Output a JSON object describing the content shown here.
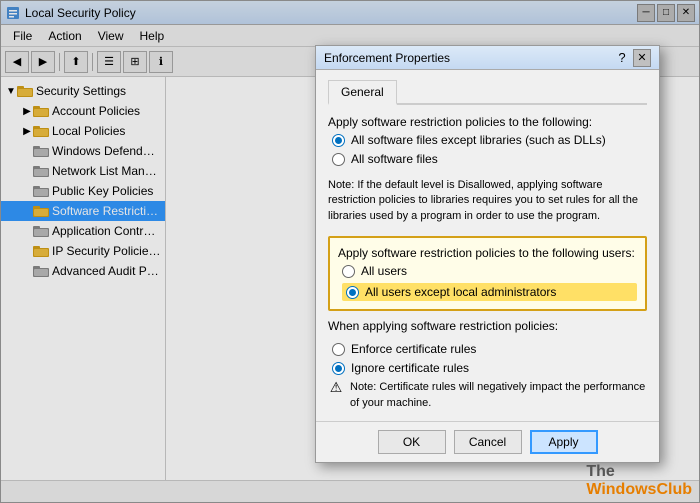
{
  "mainWindow": {
    "title": "Local Security Policy",
    "menu": [
      "File",
      "Action",
      "View",
      "Help"
    ]
  },
  "sidebar": {
    "items": [
      {
        "id": "security-settings",
        "label": "Security Settings",
        "level": 0,
        "expanded": true,
        "selected": false
      },
      {
        "id": "account-policies",
        "label": "Account Policies",
        "level": 1,
        "expanded": false,
        "selected": false
      },
      {
        "id": "local-policies",
        "label": "Local Policies",
        "level": 1,
        "expanded": false,
        "selected": false
      },
      {
        "id": "windows-defender-firewall",
        "label": "Windows Defender Firewall...",
        "level": 1,
        "expanded": false,
        "selected": false
      },
      {
        "id": "network-list-manager",
        "label": "Network List Manager Polic...",
        "level": 1,
        "expanded": false,
        "selected": false
      },
      {
        "id": "public-key-policies",
        "label": "Public Key Policies",
        "level": 1,
        "expanded": false,
        "selected": false
      },
      {
        "id": "software-restriction",
        "label": "Software Restriction Policies",
        "level": 1,
        "expanded": false,
        "selected": true
      },
      {
        "id": "application-control",
        "label": "Application Control Policies",
        "level": 1,
        "expanded": false,
        "selected": false
      },
      {
        "id": "ip-security",
        "label": "IP Security Policies on Loca...",
        "level": 1,
        "expanded": false,
        "selected": false
      },
      {
        "id": "advanced-audit",
        "label": "Advanced Audit Policy Con...",
        "level": 1,
        "expanded": false,
        "selected": false
      }
    ]
  },
  "dialog": {
    "title": "Enforcement Properties",
    "helpBtn": "?",
    "closeBtn": "✕",
    "tab": "General",
    "applySection": {
      "label": "Apply software restriction policies to the following:",
      "options": [
        {
          "id": "all-except-libraries",
          "label": "All software files except libraries (such as DLLs)",
          "checked": true
        },
        {
          "id": "all-software",
          "label": "All software files",
          "checked": false
        }
      ]
    },
    "note": "Note:  If the default level is Disallowed, applying software restriction policies to libraries requires you to set rules for all the libraries used by a program in order to use the program.",
    "usersSection": {
      "label": "Apply software restriction policies to the following users:",
      "options": [
        {
          "id": "all-users",
          "label": "All users",
          "checked": false
        },
        {
          "id": "all-except-admins",
          "label": "All users except local administrators",
          "checked": true
        }
      ]
    },
    "certSection": {
      "label": "When applying software restriction policies:",
      "options": [
        {
          "id": "enforce-cert",
          "label": "Enforce certificate rules",
          "checked": false
        },
        {
          "id": "ignore-cert",
          "label": "Ignore certificate rules",
          "checked": true
        }
      ],
      "warning": "Note:  Certificate rules will negatively impact the performance of your machine."
    },
    "buttons": {
      "ok": "OK",
      "cancel": "Cancel",
      "apply": "Apply"
    }
  },
  "statusBar": {
    "text": ""
  },
  "watermark": {
    "line1": "The",
    "line2": "WindowsClub"
  }
}
